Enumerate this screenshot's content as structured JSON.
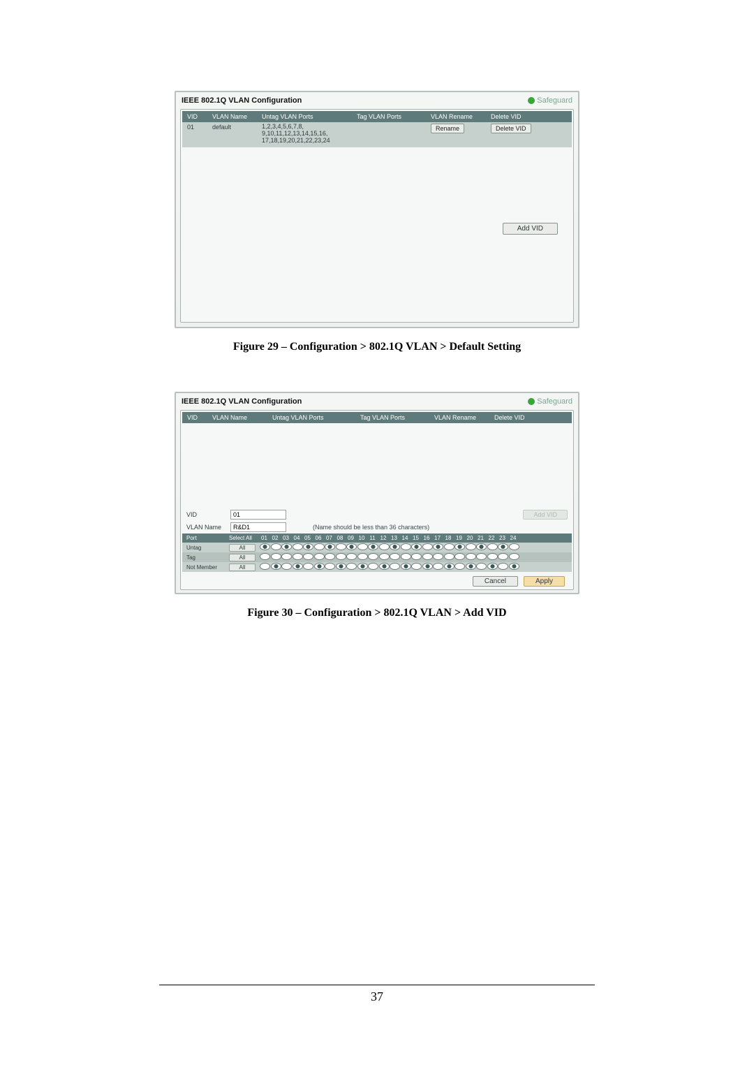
{
  "figure29": {
    "title": "IEEE 802.1Q VLAN Configuration",
    "safeguard": "Safeguard",
    "headers": {
      "vid": "VID",
      "vlan_name": "VLAN Name",
      "untag": "Untag VLAN Ports",
      "tag": "Tag VLAN Ports",
      "rename": "VLAN Rename",
      "delete": "Delete VID"
    },
    "row": {
      "vid": "01",
      "vlan_name": "default",
      "untag": "1,2,3,4,5,6,7,8,\n9,10,11,12,13,14,15,16,\n17,18,19,20,21,22,23,24",
      "tag": "",
      "rename_btn": "Rename",
      "delete_btn": "Delete VID"
    },
    "add_vid_btn": "Add VID",
    "caption": "Figure 29 – Configuration > 802.1Q VLAN > Default Setting"
  },
  "figure30": {
    "title": "IEEE 802.1Q VLAN Configuration",
    "safeguard": "Safeguard",
    "headers": {
      "vid": "VID",
      "vlan_name": "VLAN Name",
      "untag": "Untag VLAN Ports",
      "tag": "Tag VLAN Ports",
      "rename": "VLAN Rename",
      "delete": "Delete VID"
    },
    "form": {
      "vid_label": "VID",
      "vid_value": "01",
      "vlan_name_label": "VLAN Name",
      "vlan_name_value": "R&D1",
      "hint": "(Name should be less than 36 characters)",
      "add_vid_btn": "Add VID"
    },
    "port_header": {
      "port": "Port",
      "select_all": "Select All",
      "ports": [
        "01",
        "02",
        "03",
        "04",
        "05",
        "06",
        "07",
        "08",
        "09",
        "10",
        "11",
        "12",
        "13",
        "14",
        "15",
        "16",
        "17",
        "18",
        "19",
        "20",
        "21",
        "22",
        "23",
        "24"
      ]
    },
    "rows": {
      "untag": "Untag",
      "tag": "Tag",
      "not_member": "Not Member",
      "all_btn": "All"
    },
    "buttons": {
      "cancel": "Cancel",
      "apply": "Apply"
    },
    "caption": "Figure 30 – Configuration > 802.1Q VLAN > Add VID"
  },
  "page_number": "37"
}
